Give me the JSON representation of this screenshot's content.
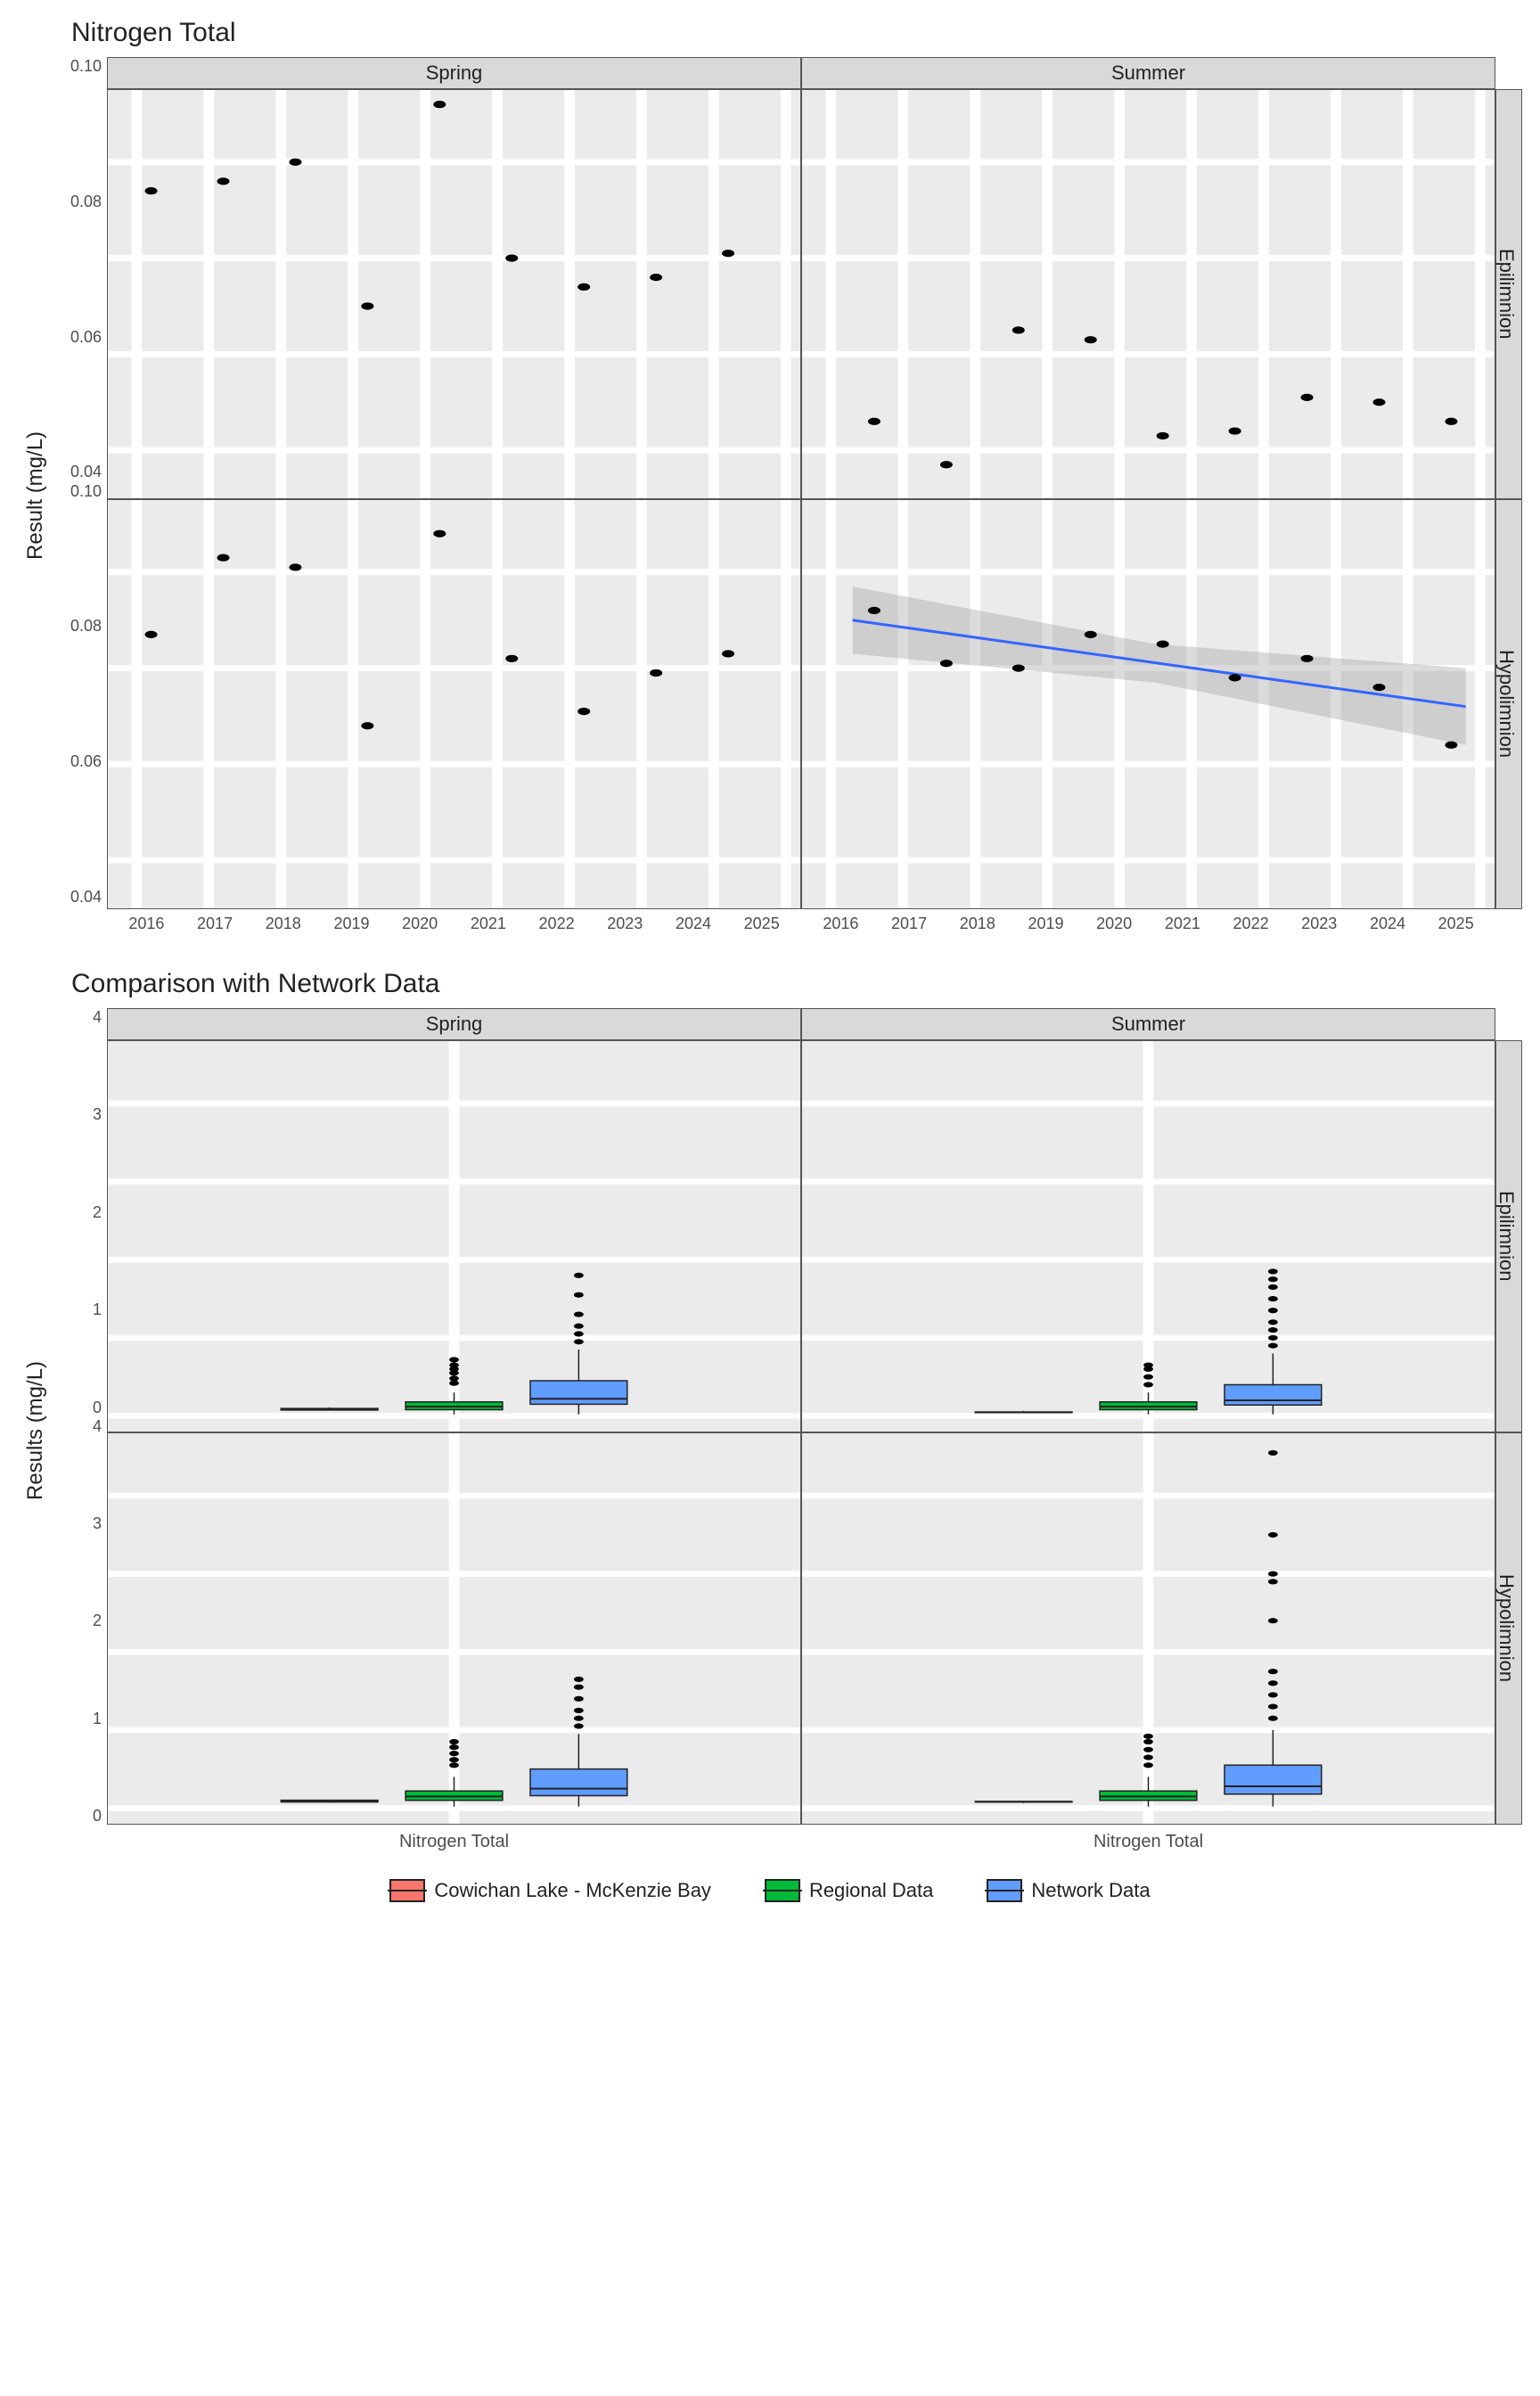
{
  "chart_data": [
    {
      "type": "scatter",
      "title": "Nitrogen Total",
      "ylabel": "Result (mg/L)",
      "xlabel": "",
      "x_ticks": [
        2016,
        2017,
        2018,
        2019,
        2020,
        2021,
        2022,
        2023,
        2024,
        2025
      ],
      "y_ticks": [
        0.04,
        0.06,
        0.08,
        0.1
      ],
      "ylim": [
        0.03,
        0.115
      ],
      "col_facets": [
        "Spring",
        "Summer"
      ],
      "row_facets": [
        "Epilimnion",
        "Hypolimnion"
      ],
      "panels": {
        "Spring_Epilimnion": {
          "points": [
            {
              "x": 2016.2,
              "y": 0.094
            },
            {
              "x": 2017.2,
              "y": 0.096
            },
            {
              "x": 2018.2,
              "y": 0.1
            },
            {
              "x": 2019.2,
              "y": 0.07
            },
            {
              "x": 2020.2,
              "y": 0.112
            },
            {
              "x": 2021.2,
              "y": 0.08
            },
            {
              "x": 2022.2,
              "y": 0.074
            },
            {
              "x": 2023.2,
              "y": 0.076
            },
            {
              "x": 2024.2,
              "y": 0.081
            }
          ]
        },
        "Summer_Epilimnion": {
          "points": [
            {
              "x": 2016.6,
              "y": 0.046
            },
            {
              "x": 2017.6,
              "y": 0.037
            },
            {
              "x": 2018.6,
              "y": 0.065
            },
            {
              "x": 2019.6,
              "y": 0.063
            },
            {
              "x": 2020.6,
              "y": 0.043
            },
            {
              "x": 2021.6,
              "y": 0.044
            },
            {
              "x": 2022.6,
              "y": 0.051
            },
            {
              "x": 2023.6,
              "y": 0.05
            },
            {
              "x": 2024.6,
              "y": 0.046
            }
          ]
        },
        "Spring_Hypolimnion": {
          "points": [
            {
              "x": 2016.2,
              "y": 0.087
            },
            {
              "x": 2017.2,
              "y": 0.103
            },
            {
              "x": 2018.2,
              "y": 0.101
            },
            {
              "x": 2019.2,
              "y": 0.068
            },
            {
              "x": 2020.2,
              "y": 0.108
            },
            {
              "x": 2021.2,
              "y": 0.082
            },
            {
              "x": 2022.2,
              "y": 0.071
            },
            {
              "x": 2023.2,
              "y": 0.079
            },
            {
              "x": 2024.2,
              "y": 0.083
            }
          ]
        },
        "Summer_Hypolimnion": {
          "points": [
            {
              "x": 2016.6,
              "y": 0.092
            },
            {
              "x": 2017.6,
              "y": 0.081
            },
            {
              "x": 2018.6,
              "y": 0.08
            },
            {
              "x": 2019.6,
              "y": 0.087
            },
            {
              "x": 2020.6,
              "y": 0.085
            },
            {
              "x": 2021.6,
              "y": 0.078
            },
            {
              "x": 2022.6,
              "y": 0.082
            },
            {
              "x": 2023.6,
              "y": 0.076
            },
            {
              "x": 2024.6,
              "y": 0.064
            }
          ],
          "trend": {
            "x1": 2016.3,
            "y1": 0.09,
            "x2": 2024.8,
            "y2": 0.072
          },
          "ribbon": [
            {
              "x": 2016.3,
              "lo": 0.083,
              "hi": 0.097
            },
            {
              "x": 2020.5,
              "lo": 0.077,
              "hi": 0.085
            },
            {
              "x": 2024.8,
              "lo": 0.064,
              "hi": 0.08
            }
          ]
        }
      }
    },
    {
      "type": "boxplot",
      "title": "Comparison with Network Data",
      "ylabel": "Results (mg/L)",
      "xlabel": "Nitrogen Total",
      "y_ticks": [
        0,
        1,
        2,
        3,
        4
      ],
      "ylim": [
        -0.2,
        4.8
      ],
      "col_facets": [
        "Spring",
        "Summer"
      ],
      "row_facets": [
        "Epilimnion",
        "Hypolimnion"
      ],
      "legend": [
        {
          "name": "Cowichan Lake - McKenzie Bay",
          "color": "#F8766D"
        },
        {
          "name": "Regional Data",
          "color": "#00BA38"
        },
        {
          "name": "Network Data",
          "color": "#619CFF"
        }
      ],
      "panels": {
        "Spring_Epilimnion": {
          "boxes": [
            {
              "group": "Cowichan Lake - McKenzie Bay",
              "min": 0.07,
              "q1": 0.075,
              "med": 0.08,
              "q3": 0.095,
              "max": 0.11,
              "outliers": []
            },
            {
              "group": "Regional Data",
              "min": 0.02,
              "q1": 0.08,
              "med": 0.12,
              "q3": 0.18,
              "max": 0.3,
              "outliers": [
                0.42,
                0.48,
                0.55,
                0.6,
                0.65,
                0.72
              ]
            },
            {
              "group": "Network Data",
              "min": 0.02,
              "q1": 0.15,
              "med": 0.22,
              "q3": 0.45,
              "max": 0.85,
              "outliers": [
                0.95,
                1.05,
                1.15,
                1.3,
                1.55,
                1.8
              ]
            }
          ]
        },
        "Summer_Epilimnion": {
          "boxes": [
            {
              "group": "Cowichan Lake - McKenzie Bay",
              "min": 0.037,
              "q1": 0.044,
              "med": 0.046,
              "q3": 0.051,
              "max": 0.065,
              "outliers": []
            },
            {
              "group": "Regional Data",
              "min": 0.02,
              "q1": 0.08,
              "med": 0.12,
              "q3": 0.18,
              "max": 0.3,
              "outliers": [
                0.4,
                0.5,
                0.6,
                0.65
              ]
            },
            {
              "group": "Network Data",
              "min": 0.02,
              "q1": 0.14,
              "med": 0.2,
              "q3": 0.4,
              "max": 0.8,
              "outliers": [
                0.9,
                1.0,
                1.1,
                1.2,
                1.35,
                1.5,
                1.65,
                1.75,
                1.85
              ]
            }
          ]
        },
        "Spring_Hypolimnion": {
          "boxes": [
            {
              "group": "Cowichan Lake - McKenzie Bay",
              "min": 0.068,
              "q1": 0.079,
              "med": 0.083,
              "q3": 0.101,
              "max": 0.108,
              "outliers": []
            },
            {
              "group": "Regional Data",
              "min": 0.02,
              "q1": 0.1,
              "med": 0.15,
              "q3": 0.22,
              "max": 0.4,
              "outliers": [
                0.55,
                0.62,
                0.7,
                0.78,
                0.85
              ]
            },
            {
              "group": "Network Data",
              "min": 0.02,
              "q1": 0.16,
              "med": 0.25,
              "q3": 0.5,
              "max": 0.95,
              "outliers": [
                1.05,
                1.15,
                1.25,
                1.4,
                1.55,
                1.65
              ]
            }
          ]
        },
        "Summer_Hypolimnion": {
          "boxes": [
            {
              "group": "Cowichan Lake - McKenzie Bay",
              "min": 0.064,
              "q1": 0.078,
              "med": 0.081,
              "q3": 0.085,
              "max": 0.092,
              "outliers": []
            },
            {
              "group": "Regional Data",
              "min": 0.02,
              "q1": 0.1,
              "med": 0.15,
              "q3": 0.22,
              "max": 0.4,
              "outliers": [
                0.55,
                0.65,
                0.75,
                0.85,
                0.92
              ]
            },
            {
              "group": "Network Data",
              "min": 0.02,
              "q1": 0.18,
              "med": 0.28,
              "q3": 0.55,
              "max": 1.0,
              "outliers": [
                1.15,
                1.3,
                1.45,
                1.6,
                1.75,
                2.4,
                2.9,
                3.0,
                3.5,
                4.55
              ]
            }
          ]
        }
      }
    }
  ]
}
